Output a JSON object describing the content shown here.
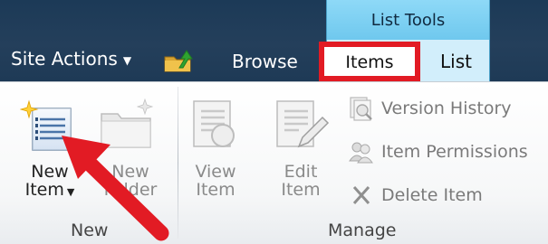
{
  "top_bar": {
    "site_actions_label": "Site Actions",
    "contextual_group_title": "List Tools",
    "tabs": [
      {
        "label": "Browse"
      },
      {
        "label": "Items"
      },
      {
        "label": "List"
      }
    ]
  },
  "ribbon": {
    "new_group": {
      "label": "New",
      "new_item": {
        "line1": "New",
        "line2": "Item"
      },
      "new_folder": {
        "line1": "New",
        "line2": "Folder"
      }
    },
    "manage_group": {
      "label": "Manage",
      "view_item": {
        "line1": "View",
        "line2": "Item"
      },
      "edit_item": {
        "line1": "Edit",
        "line2": "Item"
      },
      "version_history": "Version History",
      "item_permissions": "Item Permissions",
      "delete_item": "Delete Item"
    }
  },
  "colors": {
    "highlight_box": "#e21b24",
    "annotation_arrow": "#e21b24",
    "contextual_tab": "#8ed9f7",
    "top_bar": "#1c3a57"
  }
}
